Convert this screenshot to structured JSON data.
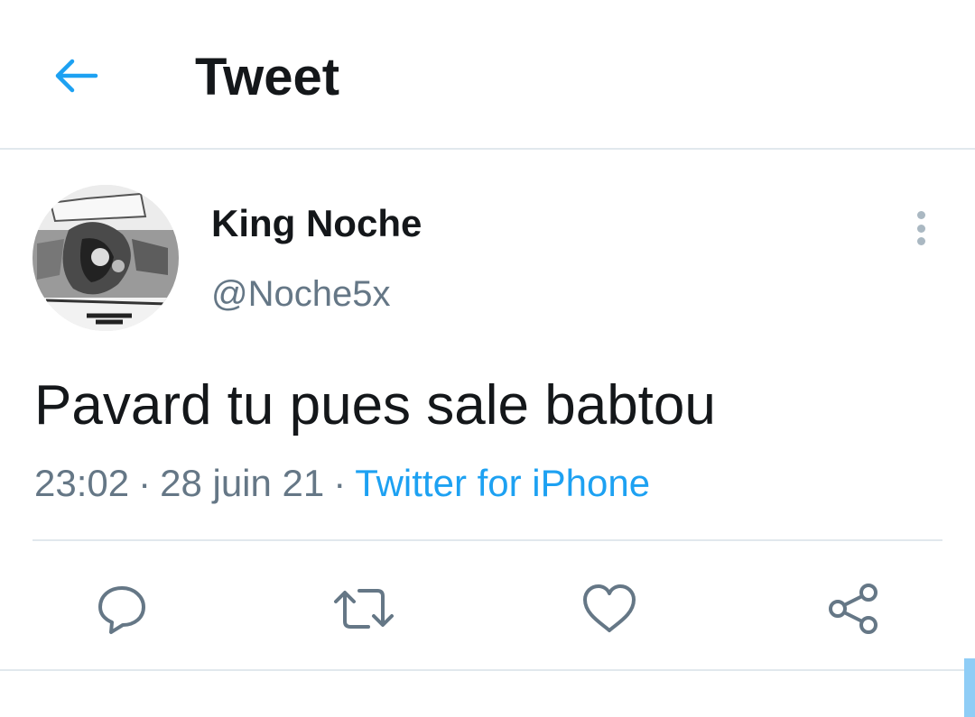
{
  "header": {
    "title": "Tweet",
    "back_icon": "arrow-left-icon"
  },
  "tweet": {
    "author": {
      "name": "King Noche",
      "handle": "@Noche5x"
    },
    "text": "Pavard tu pues sale babtou",
    "time": "23:02",
    "date": "28 juin 21",
    "separator": "·",
    "source": "Twitter for iPhone"
  },
  "actions": [
    {
      "name": "reply",
      "icon": "reply-icon"
    },
    {
      "name": "retweet",
      "icon": "retweet-icon"
    },
    {
      "name": "like",
      "icon": "heart-icon"
    },
    {
      "name": "share",
      "icon": "share-icon"
    }
  ],
  "colors": {
    "accent": "#1da1f2",
    "text": "#14171a",
    "secondary": "#657786",
    "divider": "#e1e8ed"
  }
}
